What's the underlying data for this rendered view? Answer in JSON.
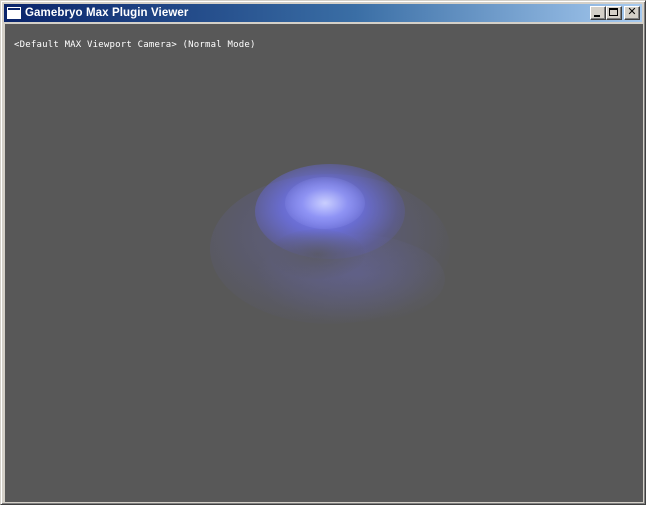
{
  "window": {
    "title": "Gamebryo Max Plugin Viewer",
    "controls": {
      "minimize_icon": "minimize-icon",
      "maximize_icon": "maximize-icon",
      "close_icon": "close-icon",
      "close_glyph": "✕"
    }
  },
  "viewport": {
    "label": "<Default MAX Viewport Camera> (Normal Mode)",
    "background_color": "#585858",
    "particle_color": "#7a80ff"
  },
  "colors": {
    "titlebar_start": "#0a246a",
    "titlebar_end": "#a6caf0",
    "window_face": "#d4d0c8"
  }
}
